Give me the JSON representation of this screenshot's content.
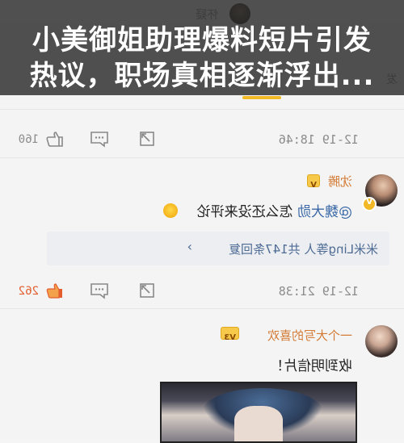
{
  "headline": {
    "line1": "小美御姐助理爆料短片引发",
    "line2": "热议，职场真相逐渐浮出..."
  },
  "top_peek": {
    "text": "怀疑",
    "side_text": "发"
  },
  "comments": [
    {
      "timestamp": "12-19 18:46",
      "like_count": "160",
      "liked": false
    },
    {
      "username": "沈腾",
      "mention": "@魏大勋",
      "text": "怎么还没来评论",
      "reply_summary": "米米Ling等人 共147条回复",
      "timestamp": "12-19 21:38",
      "like_count": "262",
      "liked": true
    },
    {
      "username": "一个大写的喜欢",
      "text": "收到明信片！"
    }
  ],
  "icons": [
    "thumbs-up-icon",
    "comment-icon",
    "share-icon",
    "chevron-right-icon",
    "verified-icon",
    "vip-icon",
    "emoji-icon"
  ],
  "colors": {
    "accent": "#f2b826",
    "username": "#d37a34",
    "link": "#4d6b95",
    "liked": "#e35d2f"
  }
}
